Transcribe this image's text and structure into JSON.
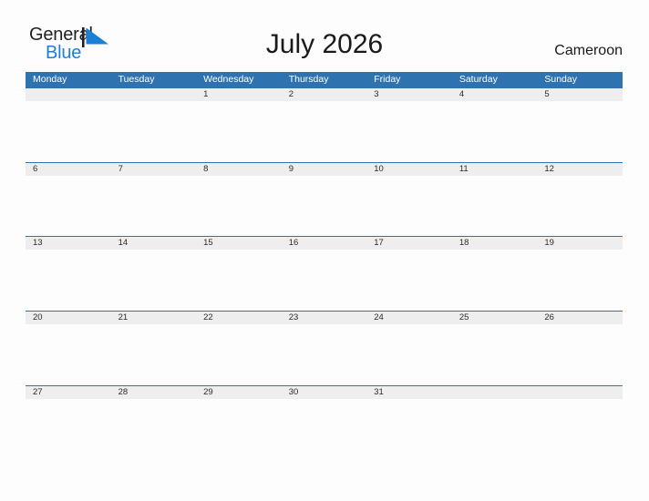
{
  "brand": {
    "name_part1": "General",
    "name_part2": "Blue",
    "flag_icon": "flag-triangle-icon",
    "accent_color": "#1b7fd4",
    "text_color": "#231f20"
  },
  "header": {
    "title": "July 2026",
    "country": "Cameroon"
  },
  "calendar": {
    "header_bg": "#2e73b0",
    "band_bg": "#eeeeee",
    "weekdays": [
      "Monday",
      "Tuesday",
      "Wednesday",
      "Thursday",
      "Friday",
      "Saturday",
      "Sunday"
    ],
    "weeks": [
      [
        "",
        "",
        "1",
        "2",
        "3",
        "4",
        "5"
      ],
      [
        "6",
        "7",
        "8",
        "9",
        "10",
        "11",
        "12"
      ],
      [
        "13",
        "14",
        "15",
        "16",
        "17",
        "18",
        "19"
      ],
      [
        "20",
        "21",
        "22",
        "23",
        "24",
        "25",
        "26"
      ],
      [
        "27",
        "28",
        "29",
        "30",
        "31",
        "",
        ""
      ]
    ]
  }
}
